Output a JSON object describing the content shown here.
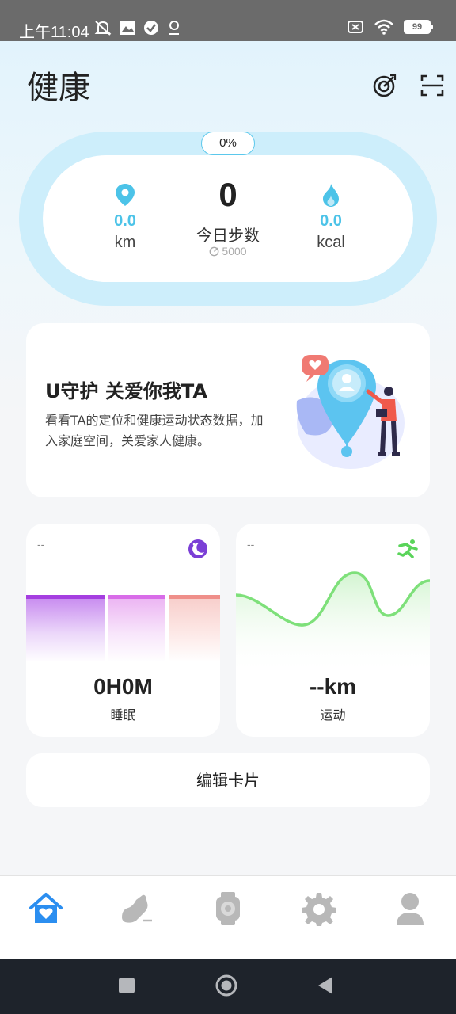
{
  "status_bar": {
    "time": "上午11:04",
    "battery": "99",
    "icons": [
      "mute-icon",
      "gallery-icon",
      "check-icon",
      "location-icon",
      "sim-off-icon",
      "wifi-icon",
      "battery-icon"
    ]
  },
  "header": {
    "title": "健康",
    "icons": [
      "target-icon",
      "scan-icon"
    ]
  },
  "steps": {
    "progress": "0%",
    "count": "0",
    "label": "今日步数",
    "goal": "5000",
    "distance_value": "0.0",
    "distance_unit": "km",
    "calorie_value": "0.0",
    "calorie_unit": "kcal"
  },
  "banner": {
    "title": "U守护 关爱你我TA",
    "description": "看看TA的定位和健康运动状态数据，加入家庭空间，关爱家人健康。"
  },
  "sleep_card": {
    "dash": "--",
    "value": "0H0M",
    "label": "睡眠",
    "icon": "moon-icon"
  },
  "sport_card": {
    "dash": "--",
    "value": "--km",
    "label": "运动",
    "icon": "running-icon"
  },
  "edit_button": "编辑卡片",
  "colors": {
    "accent": "#4cc3e8",
    "ring": "#cdeefb",
    "nav_active": "#2b8ef0",
    "nav_inactive": "#b8b8b8",
    "sleep_deep": "#a53ee0",
    "sleep_light": "#d86ce8",
    "sleep_awake": "#ef8f8a",
    "sport_line": "#7ee07a"
  },
  "bottom_nav": {
    "items": [
      "home-heart-icon",
      "shoe-icon",
      "watch-icon",
      "gear-icon",
      "profile-icon"
    ],
    "active": 0
  },
  "system_nav": [
    "recent-apps-icon",
    "home-icon",
    "back-icon"
  ]
}
